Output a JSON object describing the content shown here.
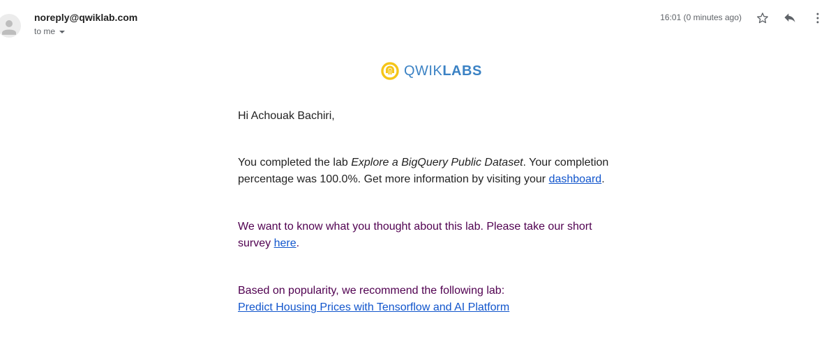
{
  "header": {
    "sender": "noreply@qwiklab.com",
    "recipient": "to me",
    "timestamp": "16:01 (0 minutes ago)",
    "icons": [
      "star-icon",
      "reply-icon",
      "more-vertical-icon"
    ]
  },
  "logo": {
    "text_light": "QWIK",
    "text_bold": "LABS",
    "colors": {
      "ring": "#f5c518",
      "text": "#3b82c4"
    }
  },
  "body": {
    "greeting": "Hi Achouak Bachiri,",
    "completion": {
      "prefix": "You completed the lab ",
      "lab_name": "Explore a BigQuery Public Dataset",
      "middle": ". Your completion percentage was 100.0%. Get more information by visiting your ",
      "link_text": "dashboard",
      "suffix": "."
    },
    "survey": {
      "prefix": "We want to know what you thought about this lab. Please take our short survey ",
      "link_text": "here",
      "suffix": "."
    },
    "recommend": {
      "text": "Based on popularity, we recommend the following lab:",
      "link_text": "Predict Housing Prices with Tensorflow and AI Platform"
    }
  }
}
